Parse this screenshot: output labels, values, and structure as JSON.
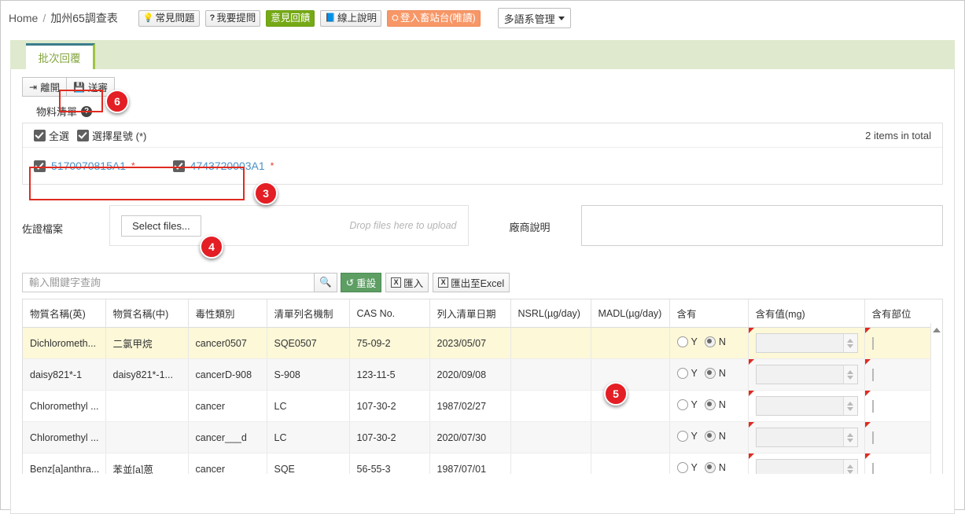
{
  "breadcrumb": {
    "home": "Home",
    "sep": "/",
    "current": "加州65調查表"
  },
  "topbuttons": [
    {
      "label": "常見問題",
      "icon": "lightbulb-icon",
      "style": "default"
    },
    {
      "label": "我要提問",
      "icon": "question-icon",
      "style": "default"
    },
    {
      "label": "意見回饋",
      "icon": "",
      "style": "green"
    },
    {
      "label": "線上說明",
      "icon": "book-icon",
      "style": "default"
    },
    {
      "label": "登入畜站台(唯讀)",
      "icon": "sitemap-icon",
      "style": "orange"
    }
  ],
  "language_menu": {
    "label": "多語系管理"
  },
  "tab": {
    "label": "批次回覆"
  },
  "actions": {
    "exit": "離開",
    "submit": "送審"
  },
  "section": {
    "material_list_label": "物料清單"
  },
  "list": {
    "select_all": "全選",
    "select_star": "選擇星號 (*)",
    "total": "2 items in total",
    "items": [
      {
        "code": "5170070815A1",
        "star": "*"
      },
      {
        "code": "4743720003A1",
        "star": "*"
      }
    ]
  },
  "upload": {
    "label": "佐證檔案",
    "select_files": "Select files...",
    "drop_hint": "Drop files here to upload"
  },
  "vendor": {
    "label": "廠商說明",
    "value": ""
  },
  "search": {
    "placeholder": "輸入關鍵字查詢",
    "value": "",
    "search_icon": "search-icon",
    "reset": "重設",
    "import": "匯入",
    "export": "匯出至Excel",
    "excel_glyph": "X"
  },
  "grid": {
    "columns": [
      "物質名稱(英)",
      "物質名稱(中)",
      "毒性類別",
      "清單列名機制",
      "CAS No.",
      "列入清單日期",
      "NSRL(µg/day)",
      "MADL(µg/day)",
      "含有",
      "含有值(mg)",
      "含有部位"
    ],
    "radio_labels": {
      "yes": "Y",
      "no": "N"
    },
    "rows": [
      {
        "highlight": "yellow",
        "name_en": "Dichlorometh...",
        "name_zh": "二氯甲烷",
        "toxic_type": "cancer0507",
        "list_mechanism": "SQE0507",
        "cas_no": "75-09-2",
        "list_date": "2023/05/07",
        "nsrl": "",
        "madl": "",
        "contains": "N",
        "contain_value": "",
        "contain_part": ""
      },
      {
        "highlight": "grey",
        "name_en": "daisy821*-1",
        "name_zh": "daisy821*-1...",
        "toxic_type": "cancerD-908",
        "list_mechanism": "S-908",
        "cas_no": "123-11-5",
        "list_date": "2020/09/08",
        "nsrl": "",
        "madl": "",
        "contains": "N",
        "contain_value": "",
        "contain_part": ""
      },
      {
        "highlight": "white",
        "name_en": "Chloromethyl ...",
        "name_zh": "",
        "toxic_type": "cancer",
        "list_mechanism": "LC",
        "cas_no": "107-30-2",
        "list_date": "1987/02/27",
        "nsrl": "",
        "madl": "",
        "contains": "N",
        "contain_value": "",
        "contain_part": ""
      },
      {
        "highlight": "grey",
        "name_en": "Chloromethyl ...",
        "name_zh": "",
        "toxic_type": "cancer___d",
        "list_mechanism": "LC",
        "cas_no": "107-30-2",
        "list_date": "2020/07/30",
        "nsrl": "",
        "madl": "",
        "contains": "N",
        "contain_value": "",
        "contain_part": ""
      },
      {
        "highlight": "white",
        "name_en": "Benz[a]anthra...",
        "name_zh": "苯並[a]蒽",
        "toxic_type": "cancer",
        "list_mechanism": "SQE",
        "cas_no": "56-55-3",
        "list_date": "1987/07/01",
        "nsrl": "",
        "madl": "",
        "contains": "N",
        "contain_value": "",
        "contain_part": ""
      }
    ]
  },
  "annotations": [
    {
      "number": "3",
      "target": "item-list-row"
    },
    {
      "number": "4",
      "target": "select-files-button"
    },
    {
      "number": "5",
      "target": "madl-column"
    },
    {
      "number": "6",
      "target": "submit-button"
    }
  ],
  "colors": {
    "accent_red": "#e31e24",
    "tab_green": "#84a640",
    "link_blue": "#4a90c4"
  }
}
